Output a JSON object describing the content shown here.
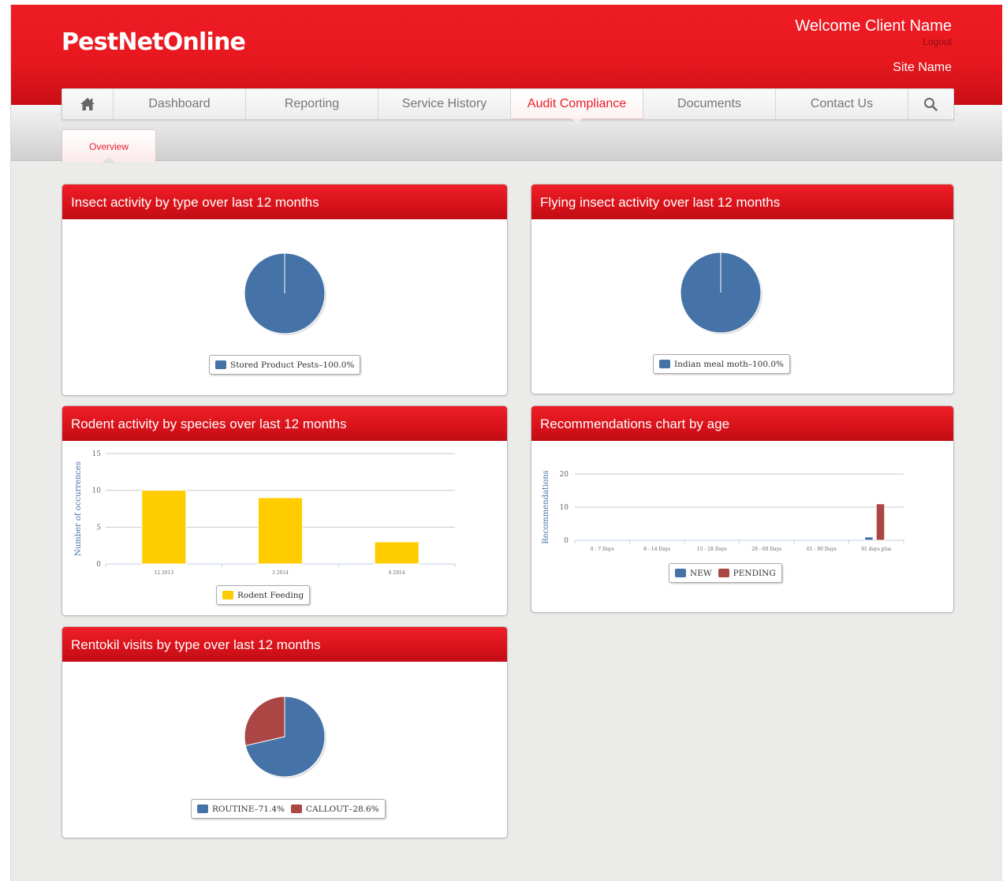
{
  "header": {
    "logo": "PestNetOnline",
    "welcome": "Welcome Client Name",
    "logout": "Logout",
    "site_name": "Site Name"
  },
  "nav": {
    "home_icon": "home-icon",
    "items": [
      {
        "label": "Dashboard"
      },
      {
        "label": "Reporting"
      },
      {
        "label": "Service History"
      },
      {
        "label": "Audit Compliance",
        "active": true
      },
      {
        "label": "Documents"
      },
      {
        "label": "Contact Us"
      }
    ],
    "search_icon": "search-icon"
  },
  "subnav": {
    "active_tab": "Overview"
  },
  "colors": {
    "brand_red": "#e8202a",
    "series_blue": "#4572a7",
    "series_red": "#aa4643",
    "series_yellow": "#ffcc00"
  },
  "cards": {
    "insect_type": {
      "title": "Insect activity by type over last 12 months"
    },
    "flying_insect": {
      "title": "Flying insect activity over last 12 months"
    },
    "rodent_species": {
      "title": "Rodent activity by species over last 12 months"
    },
    "recommendations": {
      "title": "Recommendations chart by age"
    },
    "visits": {
      "title": "Rentokil visits by type over last 12 months"
    }
  },
  "chart_data": [
    {
      "id": "insect_type",
      "type": "pie",
      "title": "Insect activity by type over last 12 months",
      "slices": [
        {
          "name": "Stored Product Pests",
          "value": 100.0,
          "color": "#4572a7"
        }
      ],
      "legend": [
        "Stored Product Pests–100.0%"
      ],
      "legend_position": "bottom"
    },
    {
      "id": "flying_insect",
      "type": "pie",
      "title": "Flying insect activity over last 12 months",
      "slices": [
        {
          "name": "Indian meal moth",
          "value": 100.0,
          "color": "#4572a7"
        }
      ],
      "legend": [
        "Indian meal moth–100.0%"
      ],
      "legend_position": "bottom"
    },
    {
      "id": "rodent_species",
      "type": "bar",
      "title": "Rodent activity by species over last 12 months",
      "categories": [
        "12 2013",
        "3 2014",
        "4 2014"
      ],
      "series": [
        {
          "name": "Rodent Feeding",
          "values": [
            10,
            9,
            3
          ],
          "color": "#ffcc00"
        }
      ],
      "ylabel": "Number of occurrences",
      "xlabel": "",
      "ylim": [
        0,
        15
      ],
      "yticks": [
        "0",
        "5",
        "10",
        "15"
      ],
      "grid": true,
      "legend_position": "bottom"
    },
    {
      "id": "recommendations",
      "type": "bar",
      "title": "Recommendations chart by age",
      "categories": [
        "0 - 7 Days",
        "8 - 14 Days",
        "15 - 28 Days",
        "29 - 60 Days",
        "61 - 90 Days",
        "91 days plus"
      ],
      "series": [
        {
          "name": "NEW",
          "values": [
            0,
            0,
            0,
            0,
            0,
            1
          ],
          "color": "#4572a7"
        },
        {
          "name": "PENDING",
          "values": [
            0,
            0,
            0,
            0,
            0,
            11
          ],
          "color": "#aa4643"
        }
      ],
      "ylabel": "Recommendations",
      "xlabel": "",
      "ylim": [
        0,
        20
      ],
      "yticks": [
        "0",
        "10",
        "20"
      ],
      "grid": true,
      "legend_position": "bottom"
    },
    {
      "id": "visits",
      "type": "pie",
      "title": "Rentokil visits by type over last 12 months",
      "slices": [
        {
          "name": "ROUTINE",
          "value": 71.4,
          "color": "#4572a7"
        },
        {
          "name": "CALLOUT",
          "value": 28.6,
          "color": "#aa4643"
        }
      ],
      "legend": [
        "ROUTINE–71.4%",
        "CALLOUT–28.6%"
      ],
      "legend_position": "bottom"
    }
  ]
}
